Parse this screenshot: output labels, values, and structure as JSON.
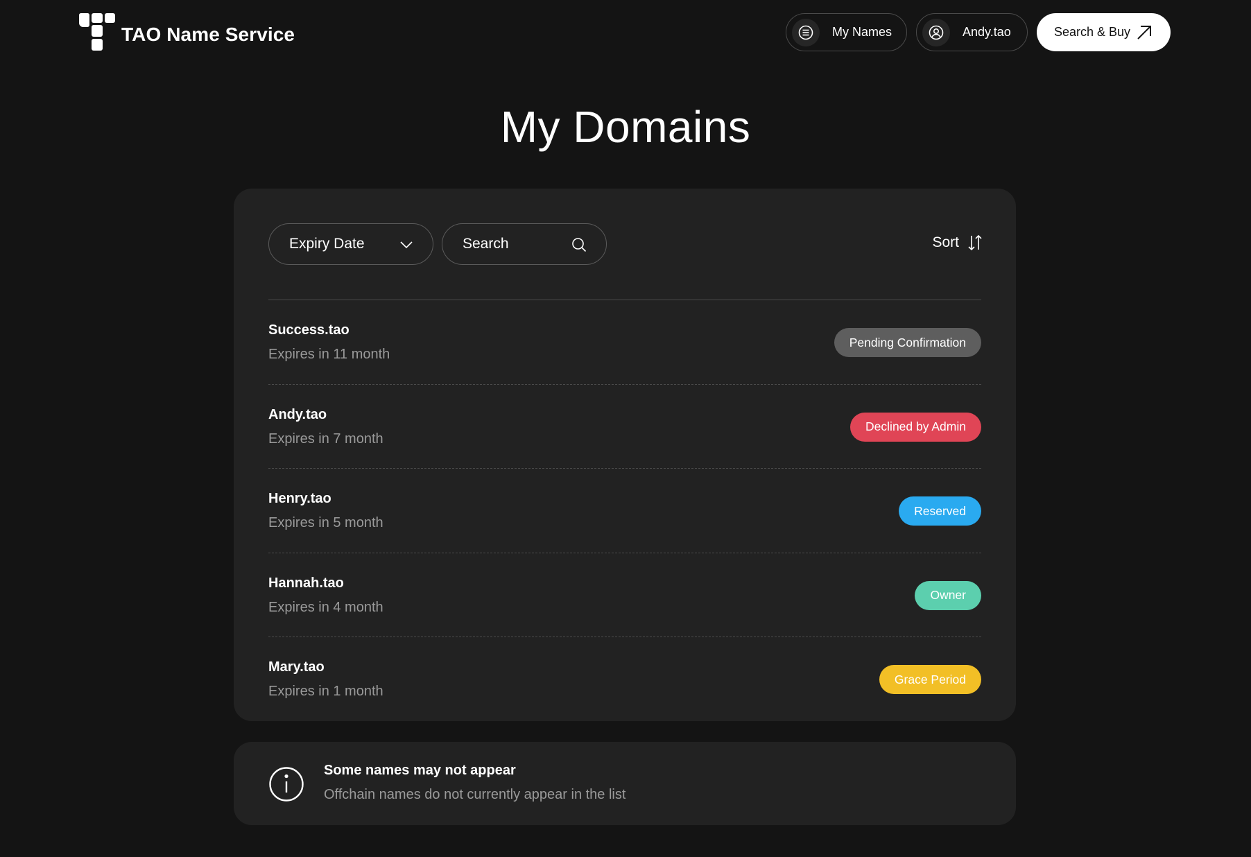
{
  "app": {
    "brand": "TAO Name Service"
  },
  "header": {
    "my_names_label": "My Names",
    "user_label": "Andy.tao",
    "search_buy_label": "Search & Buy"
  },
  "main": {
    "title": "My Domains",
    "filter": {
      "selected": "Expiry Date"
    },
    "search": {
      "placeholder": "Search"
    },
    "sort_label": "Sort",
    "domains": [
      {
        "name": "Success.tao",
        "expiry": "Expires in 11 month",
        "status": "Pending Confirmation",
        "status_color": "#5e5e5e"
      },
      {
        "name": "Andy.tao",
        "expiry": "Expires in 7 month",
        "status": "Declined by Admin",
        "status_color": "#e04556"
      },
      {
        "name": "Henry.tao",
        "expiry": "Expires in 5 month",
        "status": "Reserved",
        "status_color": "#2aaaf0"
      },
      {
        "name": "Hannah.tao",
        "expiry": "Expires in 4 month",
        "status": "Owner",
        "status_color": "#5ccfae"
      },
      {
        "name": "Mary.tao",
        "expiry": "Expires in 1 month",
        "status": "Grace Period",
        "status_color": "#f2bf26"
      }
    ]
  },
  "notice": {
    "title": "Some names may not appear",
    "subtitle": "Offchain names do not currently appear in the list"
  },
  "icons": {
    "logo": "tao-logo-icon",
    "my_names": "list-icon",
    "user": "user-circle-icon",
    "search_buy": "arrow-up-right-icon",
    "filter": "chevron-down-icon",
    "search": "search-icon",
    "sort": "sort-arrows-icon",
    "notice": "info-icon"
  }
}
